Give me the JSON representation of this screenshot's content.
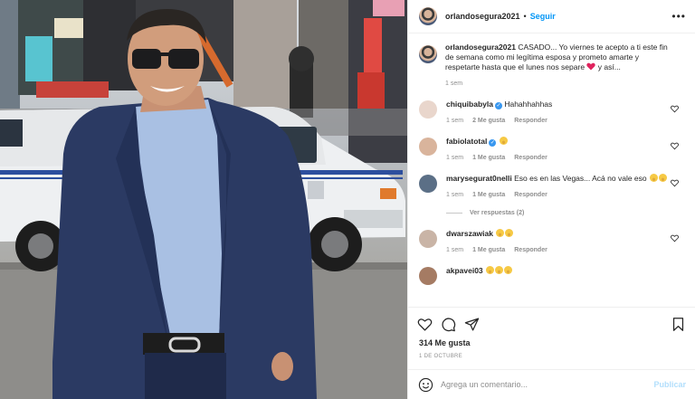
{
  "post": {
    "username": "orlandosegura2021",
    "follow_label": "Seguir",
    "more_label": "•••",
    "separator": "•"
  },
  "caption": {
    "username": "orlandosegura2021",
    "text": "CASADO... Yo viernes te acepto a ti este fin de semana como mi legítima esposa y prometo amarte y respetarte hasta que el lunes nos separe",
    "text_after_heart": "y así...",
    "time": "1 sem"
  },
  "comments": [
    {
      "username": "chiquibabyla",
      "verified": true,
      "text": "Hahahhahhas",
      "time": "1 sem",
      "likes": "2 Me gusta",
      "reply": "Responder",
      "avatar_color": "#e9d6cc"
    },
    {
      "username": "fabiolatotal",
      "verified": true,
      "text": "",
      "emojis": 1,
      "time": "1 sem",
      "likes": "1 Me gusta",
      "reply": "Responder",
      "avatar_color": "#d9b49c"
    },
    {
      "username": "marysegurat0nelli",
      "verified": false,
      "text": "Eso es en las Vegas... Acá no vale eso",
      "emojis": 2,
      "time": "1 sem",
      "likes": "1 Me gusta",
      "reply": "Responder",
      "avatar_color": "#5b6f86"
    },
    {
      "username": "dwarszawiak",
      "verified": false,
      "text": "",
      "emojis": 2,
      "time": "1 sem",
      "likes": "1 Me gusta",
      "reply": "Responder",
      "avatar_color": "#c9b4a6"
    },
    {
      "username": "akpavei03",
      "verified": false,
      "text": "",
      "emojis": 3,
      "time": "",
      "likes": "",
      "reply": "",
      "avatar_color": "#a57b63"
    }
  ],
  "view_replies": "Ver respuestas (2)",
  "likes_count": "314 Me gusta",
  "post_date": "1 DE OCTUBRE",
  "add_comment": {
    "placeholder": "Agrega un comentario...",
    "publish_label": "Publicar"
  },
  "icons": {
    "like": "heart-icon",
    "comment": "comment-icon",
    "share": "paper-plane-icon",
    "save": "bookmark-icon",
    "emoji": "smiley-icon",
    "more": "ellipsis-icon"
  },
  "colors": {
    "accent": "#0095f6",
    "publish_disabled": "#b2dffc",
    "verified": "#3897f0",
    "text": "#262626",
    "muted": "#8e8e8e"
  }
}
